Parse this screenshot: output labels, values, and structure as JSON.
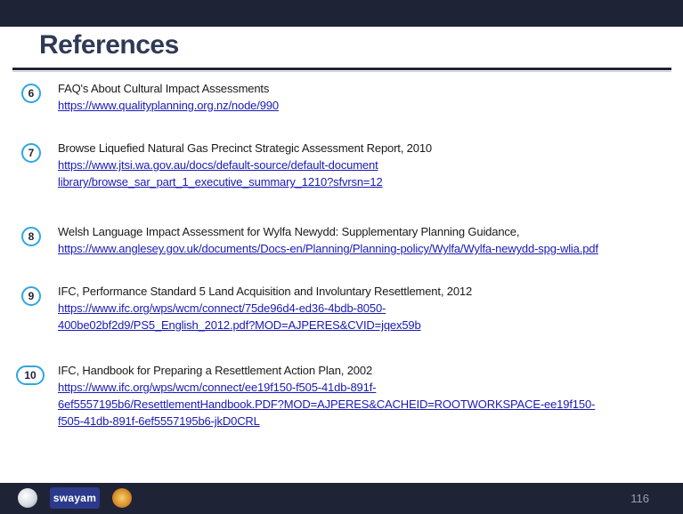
{
  "slide": {
    "title": "References",
    "page_number": "116"
  },
  "references": [
    {
      "number": "6",
      "title": "FAQ's About Cultural Impact Assessments",
      "links": [
        "https://www.qualityplanning.org.nz/node/990"
      ]
    },
    {
      "number": "7",
      "title": "Browse Liquefied Natural Gas Precinct Strategic Assessment Report, 2010",
      "links": [
        "https://www.jtsi.wa.gov.au/docs/default-source/default-document",
        "library/browse_sar_part_1_executive_summary_1210?sfvrsn=12"
      ]
    },
    {
      "number": "8",
      "title": "Welsh Language Impact Assessment for Wylfa Newydd: Supplementary Planning Guidance,",
      "links": [
        "https://www.anglesey.gov.uk/documents/Docs-en/Planning/Planning-policy/Wylfa/Wylfa-newydd-spg-wlia.pdf"
      ]
    },
    {
      "number": "9",
      "title": "IFC, Performance Standard 5 Land Acquisition and Involuntary Resettlement, 2012",
      "links": [
        "https://www.ifc.org/wps/wcm/connect/75de96d4-ed36-4bdb-8050-",
        "400be02bf2d9/PS5_English_2012.pdf?MOD=AJPERES&CVID=jqex59b"
      ]
    },
    {
      "number": "10",
      "title": "IFC, Handbook for Preparing a Resettlement Action Plan, 2002",
      "links": [
        "https://www.ifc.org/wps/wcm/connect/ee19f150-f505-41db-891f-",
        "6ef5557195b6/ResettlementHandbook.PDF?MOD=AJPERES&CACHEID=ROOTWORKSPACE-ee19f150-",
        "f505-41db-891f-6ef5557195b6-jkD0CRL"
      ]
    }
  ],
  "footer": {
    "swayam_label": "swayam"
  }
}
